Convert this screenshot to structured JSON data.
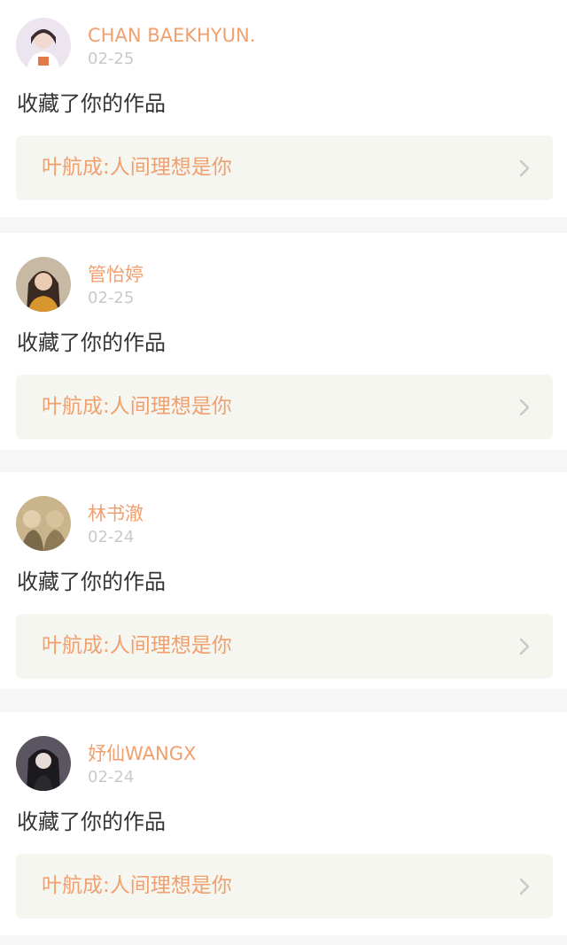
{
  "notifications": [
    {
      "username": "CHAN BAEKHYUN.",
      "date": "02-25",
      "action": "收藏了你的作品",
      "work_title": "叶航成:人间理想是你",
      "avatar_icon": "user-avatar-icon"
    },
    {
      "username": "管怡婷",
      "date": "02-25",
      "action": "收藏了你的作品",
      "work_title": "叶航成:人间理想是你",
      "avatar_icon": "user-avatar-icon"
    },
    {
      "username": "林书澈",
      "date": "02-24",
      "action": "收藏了你的作品",
      "work_title": "叶航成:人间理想是你",
      "avatar_icon": "user-avatar-icon"
    },
    {
      "username": "妤仙WANGX",
      "date": "02-24",
      "action": "收藏了你的作品",
      "work_title": "叶航成:人间理想是你",
      "avatar_icon": "user-avatar-icon"
    }
  ],
  "colors": {
    "accent": "#f0a06f",
    "date": "#c9c9c9",
    "text": "#333333",
    "link_bg": "#f6f6f0",
    "separator": "#f6f6f6"
  }
}
